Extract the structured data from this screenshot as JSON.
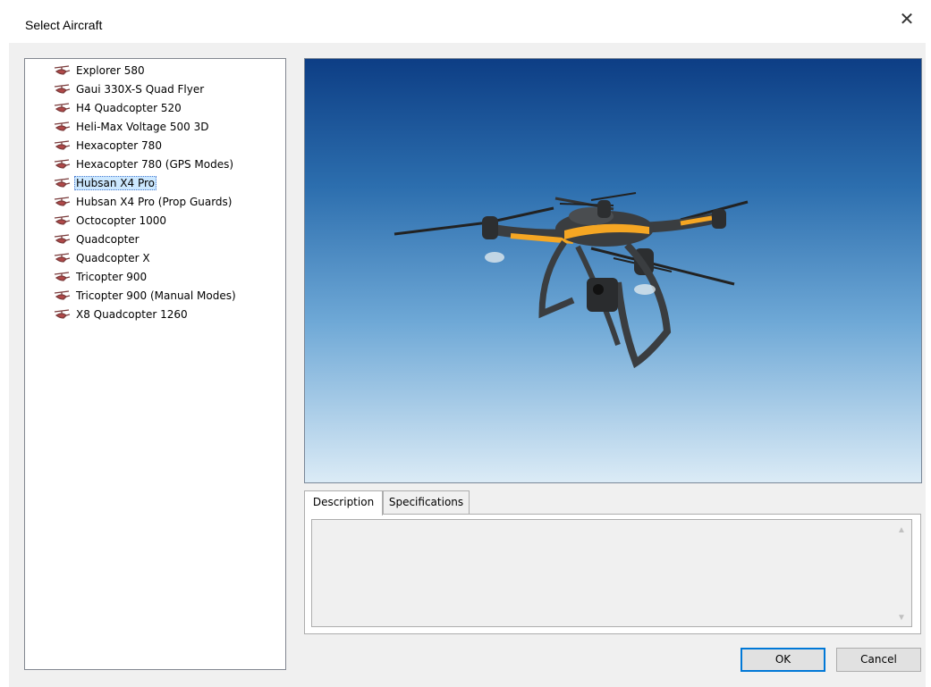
{
  "window": {
    "title": "Select Aircraft",
    "close_glyph": "✕"
  },
  "aircraft_list": {
    "selected_index": 6,
    "items": [
      {
        "label": "Explorer 580"
      },
      {
        "label": "Gaui 330X-S Quad Flyer"
      },
      {
        "label": "H4 Quadcopter 520"
      },
      {
        "label": "Heli-Max Voltage 500 3D"
      },
      {
        "label": "Hexacopter 780"
      },
      {
        "label": "Hexacopter 780 (GPS Modes)"
      },
      {
        "label": "Hubsan X4 Pro"
      },
      {
        "label": "Hubsan X4 Pro (Prop Guards)"
      },
      {
        "label": "Octocopter 1000"
      },
      {
        "label": "Quadcopter"
      },
      {
        "label": "Quadcopter X"
      },
      {
        "label": "Tricopter 900"
      },
      {
        "label": "Tricopter 900 (Manual Modes)"
      },
      {
        "label": "X8 Quadcopter 1260"
      }
    ]
  },
  "tabs": [
    {
      "label": "Description"
    },
    {
      "label": "Specifications"
    }
  ],
  "description": {
    "text": ""
  },
  "buttons": {
    "ok": "OK",
    "cancel": "Cancel"
  },
  "colors": {
    "sky_top": "#0d3e85",
    "sky_bottom": "#dbebf6",
    "drone_body": "#3a3d40",
    "drone_accent": "#f5a623",
    "selection": "#cce8ff"
  }
}
